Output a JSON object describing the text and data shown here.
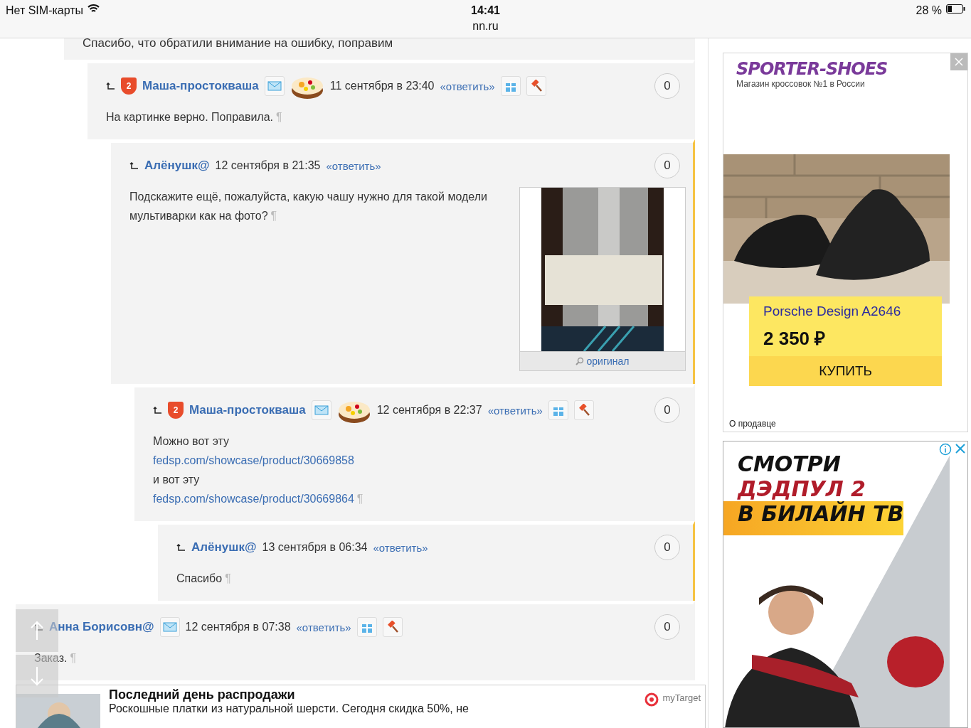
{
  "status_bar": {
    "carrier": "Нет SIM-карты",
    "time": "14:41",
    "url": "nn.ru",
    "battery": "28 %"
  },
  "comments": [
    {
      "kind": "fragment",
      "text": "Спасибо, что обратили внимание на ошибку, поправим",
      "children": [
        {
          "kind": "comment",
          "author": "Маша-простокваша",
          "badge": "2",
          "mail": true,
          "avatar": true,
          "date": "11 сентября в 23:40",
          "reply": "«ответить»",
          "actions": true,
          "score": "0",
          "highlighted": false,
          "end_mark": "¶",
          "lines": [
            {
              "kind": "text",
              "text": "На картинке верно. Поправила."
            }
          ],
          "children": [
            {
              "kind": "comment",
              "author": "Алёнушк@",
              "date": "12 сентября в 21:35",
              "reply": "«ответить»",
              "score": "0",
              "highlighted": true,
              "end_mark": "¶",
              "lines": [
                {
                  "kind": "text",
                  "text": "Подскажите ещё, пожалуйста, какую чашу нужно для такой модели мультиварки как на фото?"
                }
              ],
              "attachment": {
                "caption": "оригинал"
              },
              "children": [
                {
                  "kind": "comment",
                  "author": "Маша-простокваша",
                  "badge": "2",
                  "mail": true,
                  "avatar": true,
                  "date": "12 сентября в 22:37",
                  "reply": "«ответить»",
                  "actions": true,
                  "score": "0",
                  "highlighted": false,
                  "end_mark": "¶",
                  "lines": [
                    {
                      "kind": "text",
                      "text": "Можно вот эту"
                    },
                    {
                      "kind": "link",
                      "text": "fedsp.com/showcase/product/30669858"
                    },
                    {
                      "kind": "text",
                      "text": "и вот эту"
                    },
                    {
                      "kind": "link",
                      "text": "fedsp.com/showcase/product/30669864"
                    }
                  ],
                  "children": [
                    {
                      "kind": "comment",
                      "author": "Алёнушк@",
                      "date": "13 сентября в 06:34",
                      "reply": "«ответить»",
                      "score": "0",
                      "highlighted": true,
                      "end_mark": "¶",
                      "lines": [
                        {
                          "kind": "text",
                          "text": "Спасибо"
                        }
                      ]
                    }
                  ]
                }
              ]
            }
          ]
        }
      ]
    },
    {
      "kind": "comment",
      "author": "Анна Борисовн@",
      "mail": true,
      "date": "12 сентября в 07:38",
      "reply": "«ответить»",
      "actions": true,
      "score": "0",
      "highlighted": false,
      "end_mark": "¶",
      "lines": [
        {
          "kind": "text",
          "text": "Заказ."
        }
      ]
    }
  ],
  "bottom_ad": {
    "title": "Последний день распродажи",
    "description": "Роскошные платки из натуральной шерсти. Сегодня скидка 50%, не",
    "brand": "myTarget"
  },
  "shoe_ad": {
    "logo": "SPORTER-SHOES",
    "tagline": "Магазин кроссовок №1 в России",
    "product": "Porsche Design A2646",
    "price": "2 350 ₽",
    "buy": "КУПИТЬ",
    "seller": "О продавце"
  },
  "tv_ad": {
    "line_1": "СМОТРИ",
    "line_2": "ДЭДПУЛ 2",
    "line_3": "В БИЛАЙН ТВ"
  }
}
